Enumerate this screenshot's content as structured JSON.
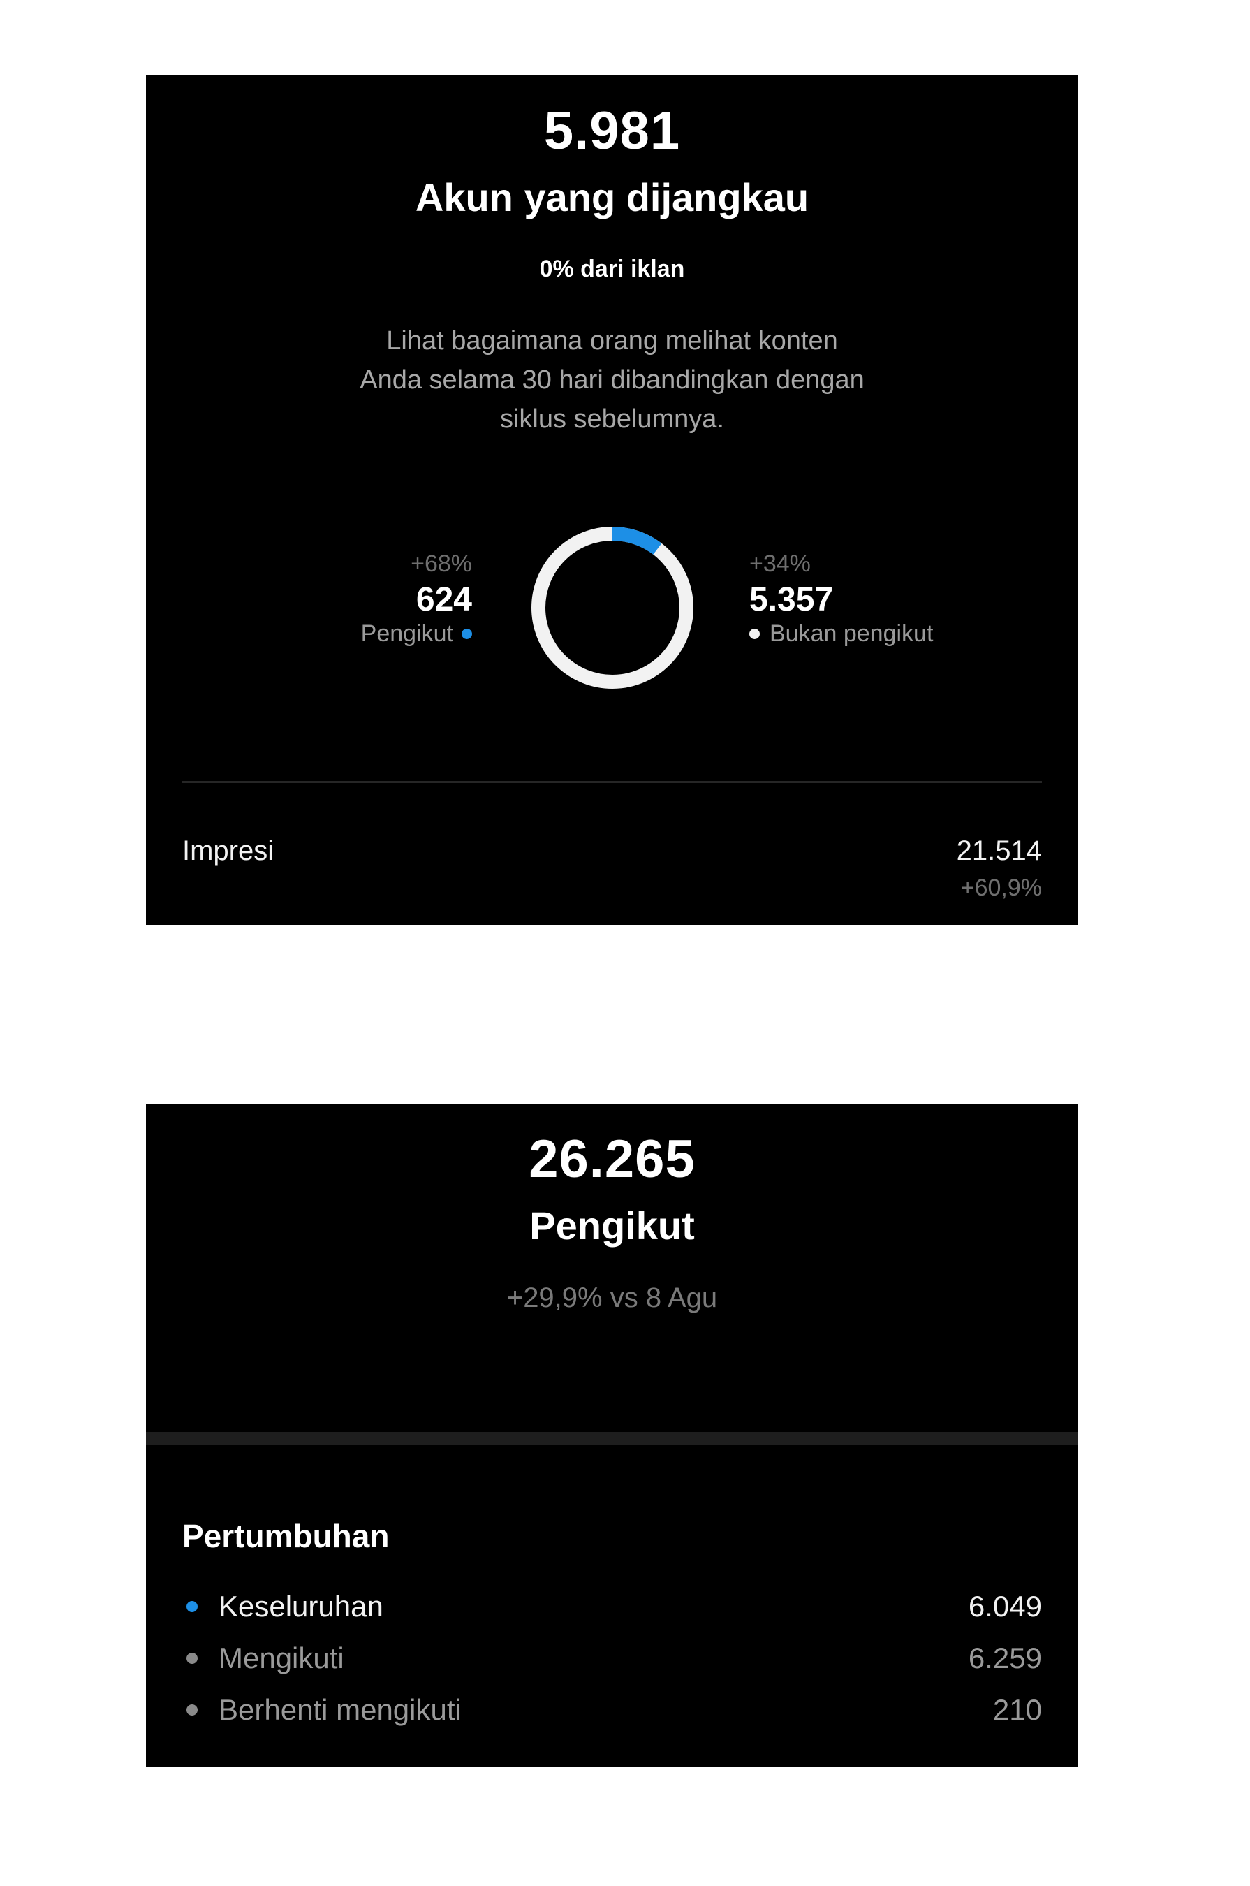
{
  "reach": {
    "total": "5.981",
    "title": "Akun yang dijangkau",
    "ads_line": "0% dari iklan",
    "description": "Lihat bagaimana orang melihat konten Anda selama 30 hari dibandingkan dengan siklus sebelumnya.",
    "followers": {
      "change": "+68%",
      "value": "624",
      "label": "Pengikut"
    },
    "non_followers": {
      "change": "+34%",
      "value": "5.357",
      "label": "Bukan pengikut"
    },
    "donut": {
      "followers_fraction": 0.104,
      "followers_color": "#1d8fe6",
      "non_followers_color": "#f2f2f2"
    },
    "impressions": {
      "label": "Impresi",
      "value": "21.514",
      "change": "+60,9%"
    }
  },
  "followers_panel": {
    "total": "26.265",
    "title": "Pengikut",
    "vs_line": "+29,9% vs 8 Agu",
    "growth": {
      "title": "Pertumbuhan",
      "rows": [
        {
          "name": "Keseluruhan",
          "value": "6.049",
          "dot_color": "#1d8fe6",
          "text_color": "#f2f2f2"
        },
        {
          "name": "Mengikuti",
          "value": "6.259",
          "dot_color": "#8a8a8a",
          "text_color": "#9a9a9a"
        },
        {
          "name": "Berhenti mengikuti",
          "value": "210",
          "dot_color": "#8a8a8a",
          "text_color": "#9a9a9a"
        }
      ]
    }
  }
}
